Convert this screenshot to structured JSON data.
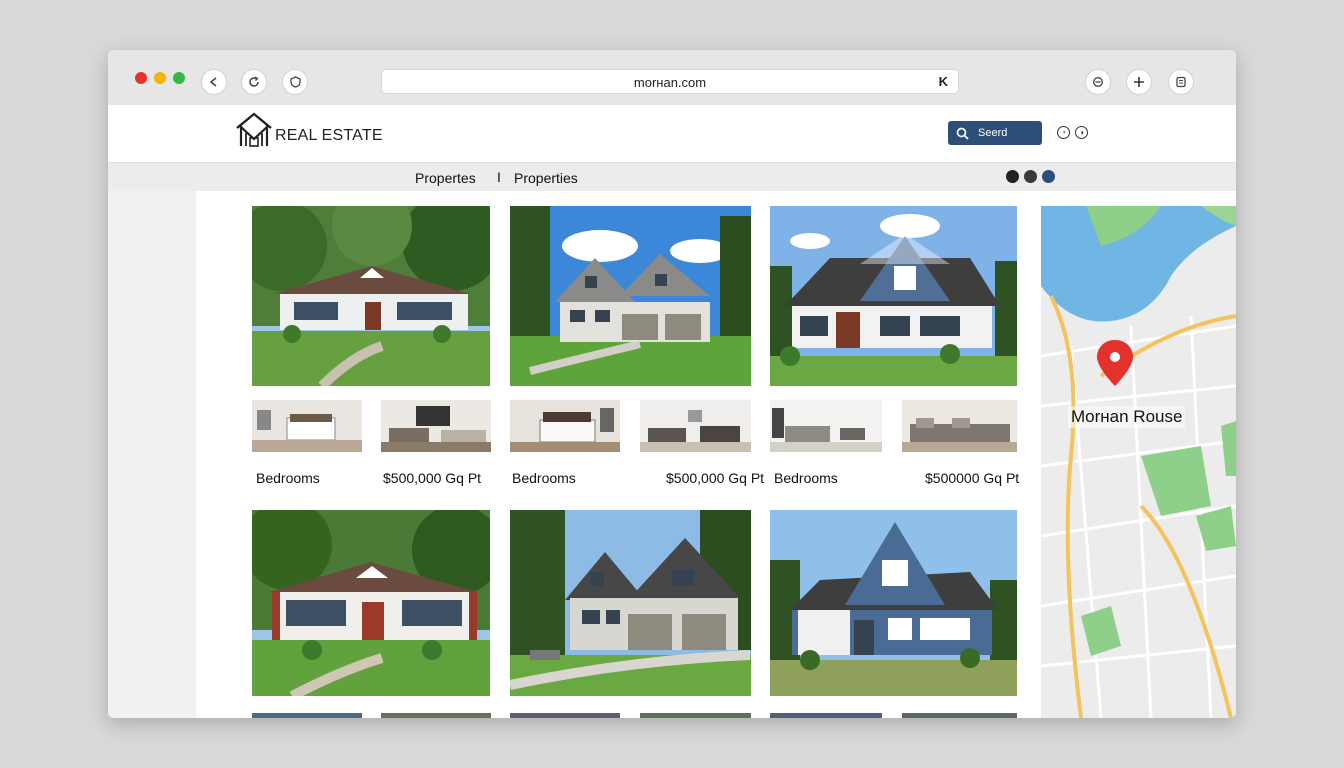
{
  "browser": {
    "url": "morнan.com",
    "url_right_glyph": "K",
    "traffic_lights": [
      "#e5332a",
      "#f4b400",
      "#33b84a"
    ]
  },
  "header": {
    "brand": "REAL ESTATE",
    "search_label": "Seerd",
    "accent": "#2c4e78"
  },
  "nav": {
    "items": [
      "Propertes",
      "Properties"
    ],
    "separator": "I"
  },
  "listings": {
    "labels": [
      {
        "text": "Bedrooms"
      },
      {
        "text": "$500,000 Gq Pt"
      },
      {
        "text": "Bedrooms"
      },
      {
        "text": "$500,000 Gq Pt"
      },
      {
        "text": "Bedrooms"
      },
      {
        "text": "$500000 Gq Pt"
      }
    ]
  },
  "map": {
    "pin_label": "Morнan Rouse"
  }
}
